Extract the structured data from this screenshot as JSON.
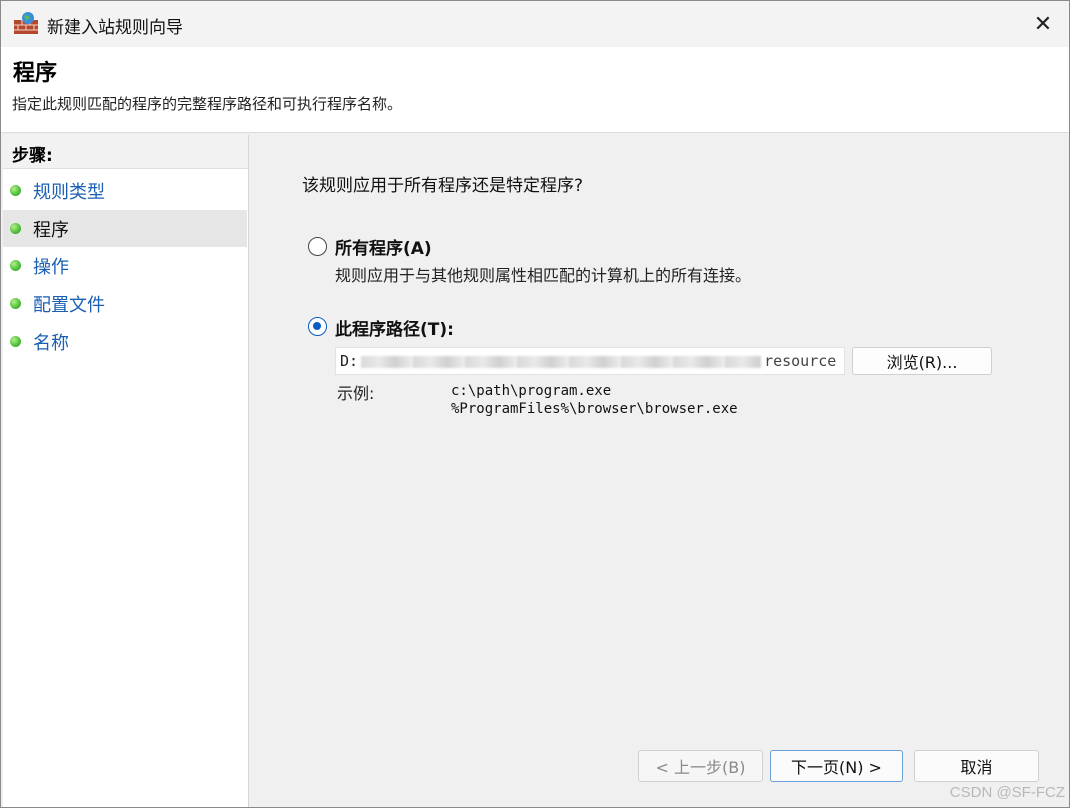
{
  "window": {
    "title": "新建入站规则向导",
    "close_glyph": "✕"
  },
  "header": {
    "title": "程序",
    "description": "指定此规则匹配的程序的完整程序路径和可执行程序名称。"
  },
  "sidebar": {
    "heading": "步骤:",
    "steps": [
      {
        "label": "规则类型",
        "active": false
      },
      {
        "label": "程序",
        "active": true
      },
      {
        "label": "操作",
        "active": false
      },
      {
        "label": "配置文件",
        "active": false
      },
      {
        "label": "名称",
        "active": false
      }
    ]
  },
  "main": {
    "question": "该规则应用于所有程序还是特定程序?",
    "option_all": {
      "label": "所有程序(A)",
      "description": "规则应用于与其他规则属性相匹配的计算机上的所有连接。",
      "checked": false
    },
    "option_path": {
      "label": "此程序路径(T):",
      "checked": true
    },
    "path_input": {
      "value_prefix": "D:",
      "value_suffix": "resource"
    },
    "browse_label": "浏览(R)...",
    "example_label": "示例:",
    "example_lines": [
      "c:\\path\\program.exe",
      "%ProgramFiles%\\browser\\browser.exe"
    ]
  },
  "footer": {
    "back_label": "< 上一步(B)",
    "next_label": "下一页(N) >",
    "cancel_label": "取消"
  },
  "watermark": "CSDN @SF-FCZ",
  "colors": {
    "link": "#1a5fb4",
    "radio_selected": "#0a5bc4",
    "step_dot": "#4fc23b"
  }
}
